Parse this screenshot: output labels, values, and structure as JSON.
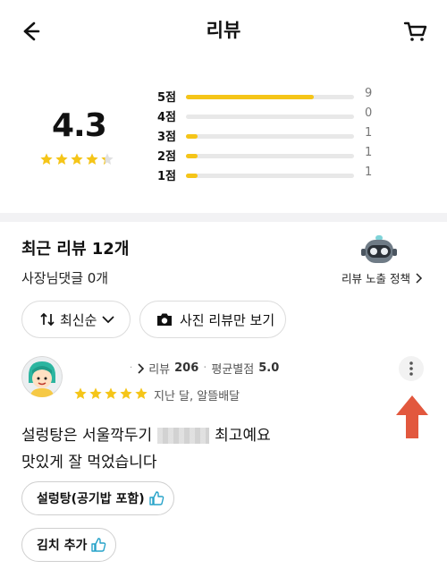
{
  "header": {
    "title": "리뷰",
    "back_icon": "arrow-left-icon",
    "cart_icon": "cart-icon"
  },
  "summary": {
    "average": "4.3",
    "average_value": 4.3,
    "distribution": [
      {
        "label": "5점",
        "count": "9",
        "fraction": 0.76
      },
      {
        "label": "4점",
        "count": "0",
        "fraction": 0.0
      },
      {
        "label": "3점",
        "count": "1",
        "fraction": 0.07
      },
      {
        "label": "2점",
        "count": "1",
        "fraction": 0.07
      },
      {
        "label": "1점",
        "count": "1",
        "fraction": 0.07
      }
    ],
    "bar_color": "#f5c518"
  },
  "recent": {
    "title": "최근 리뷰 12개",
    "owner_reply": "사장님댓글 0개",
    "policy_label": "리뷰 노출 정책",
    "policy_icon": "chevron-right-icon"
  },
  "filters": {
    "sort_label": "최신순",
    "photo_label": "사진 리뷰만 보기"
  },
  "review": {
    "meta_reviews_label": "리뷰",
    "meta_reviews_count": "206",
    "meta_avg_label": "평균별점",
    "meta_avg_value": "5.0",
    "rating": 5,
    "date": "지난 달, 알뜰배달",
    "text_line1_a": "설렁탕은 서울깍두기",
    "text_line1_b": "최고예요",
    "text_line2": "맛있게 잘 먹었습니다",
    "tags": [
      "설렁탕(공기밥 포함)",
      "김치 추가"
    ],
    "annotation_color": "#e2583e"
  }
}
